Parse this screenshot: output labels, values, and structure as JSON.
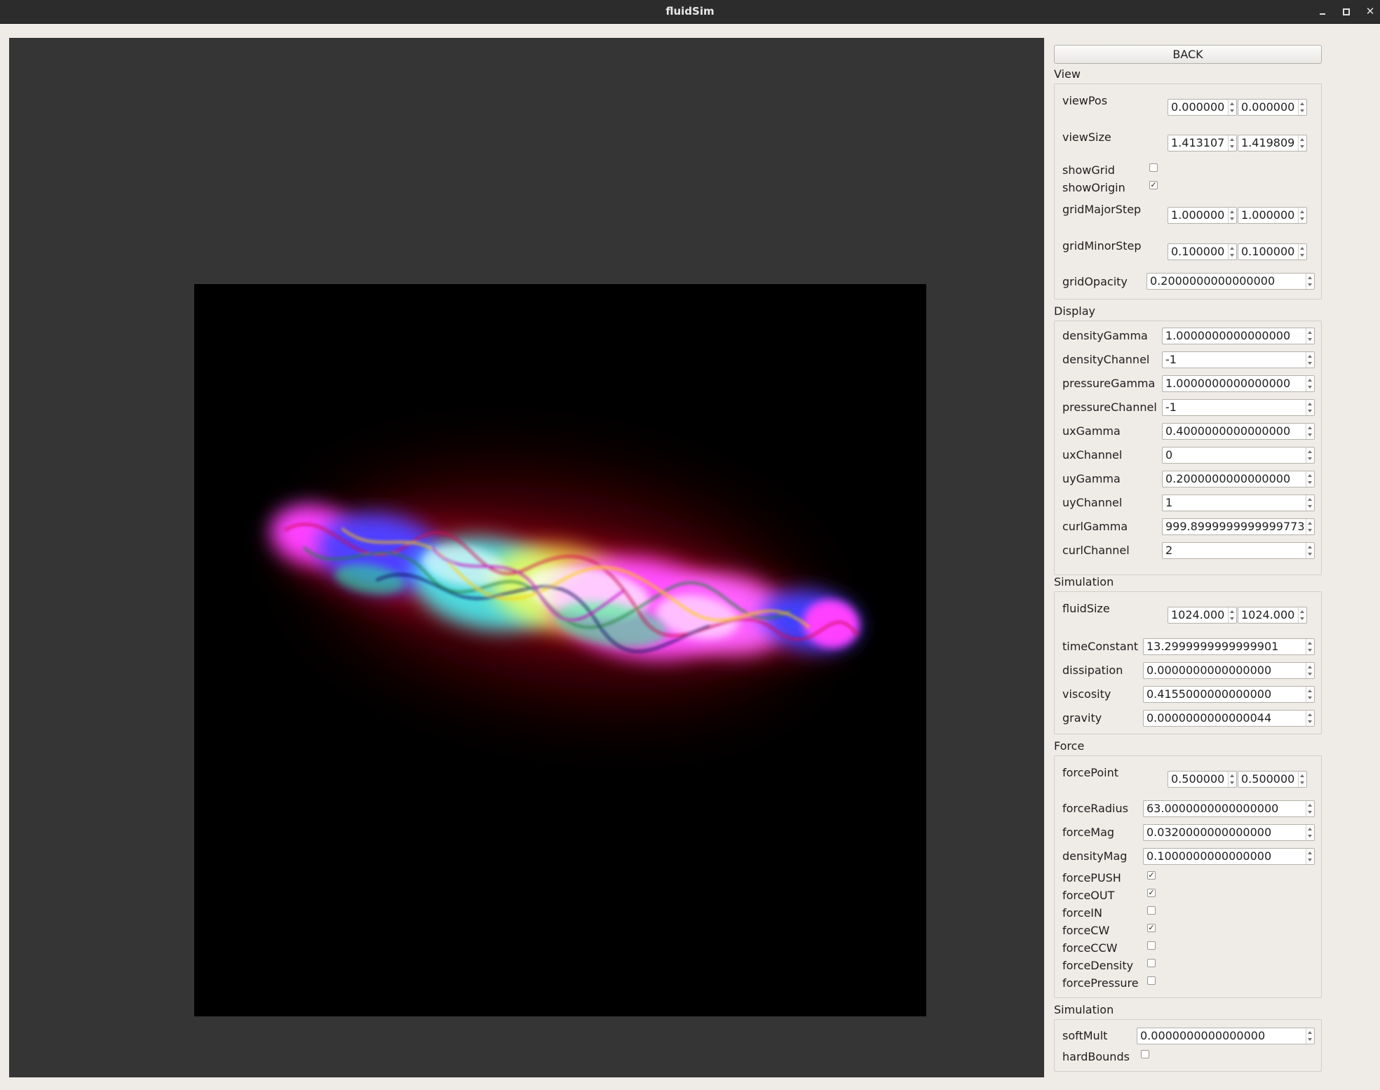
{
  "window": {
    "title": "fluidSim",
    "minimize_icon": "minimize-icon",
    "maximize_icon": "maximize-icon",
    "close_icon": "close-icon",
    "close_glyph": "✕"
  },
  "panel": {
    "back_label": "BACK",
    "view": {
      "title": "View",
      "viewPos": {
        "label": "viewPos",
        "x": "0.000000",
        "y": "0.000000"
      },
      "viewSize": {
        "label": "viewSize",
        "x": "1.413107",
        "y": "1.419809"
      },
      "showGrid": {
        "label": "showGrid",
        "checked": false
      },
      "showOrigin": {
        "label": "showOrigin",
        "checked": true
      },
      "gridMajorStep": {
        "label": "gridMajorStep",
        "x": "1.000000",
        "y": "1.000000"
      },
      "gridMinorStep": {
        "label": "gridMinorStep",
        "x": "0.100000",
        "y": "0.100000"
      },
      "gridOpacity": {
        "label": "gridOpacity",
        "value": "0.2000000000000000"
      }
    },
    "display": {
      "title": "Display",
      "fields": [
        {
          "label": "densityGamma",
          "value": "1.0000000000000000"
        },
        {
          "label": "densityChannel",
          "value": "-1"
        },
        {
          "label": "pressureGamma",
          "value": "1.0000000000000000"
        },
        {
          "label": "pressureChannel",
          "value": "-1"
        },
        {
          "label": "uxGamma",
          "value": "0.4000000000000000"
        },
        {
          "label": "uxChannel",
          "value": "0"
        },
        {
          "label": "uyGamma",
          "value": "0.2000000000000000"
        },
        {
          "label": "uyChannel",
          "value": "1"
        },
        {
          "label": "curlGamma",
          "value": "999.8999999999999773"
        },
        {
          "label": "curlChannel",
          "value": "2"
        }
      ]
    },
    "simulation": {
      "title": "Simulation",
      "fluidSize": {
        "label": "fluidSize",
        "x": "1024.000",
        "y": "1024.000"
      },
      "fields": [
        {
          "label": "timeConstant",
          "value": "13.2999999999999901"
        },
        {
          "label": "dissipation",
          "value": "0.0000000000000000"
        },
        {
          "label": "viscosity",
          "value": "0.4155000000000000"
        },
        {
          "label": "gravity",
          "value": "0.0000000000000044"
        }
      ]
    },
    "force": {
      "title": "Force",
      "forcePoint": {
        "label": "forcePoint",
        "x": "0.500000",
        "y": "0.500000"
      },
      "fields": [
        {
          "label": "forceRadius",
          "value": "63.0000000000000000"
        },
        {
          "label": "forceMag",
          "value": "0.0320000000000000"
        },
        {
          "label": "densityMag",
          "value": "0.1000000000000000"
        }
      ],
      "checks": [
        {
          "label": "forcePUSH",
          "checked": true
        },
        {
          "label": "forceOUT",
          "checked": true
        },
        {
          "label": "forceIN",
          "checked": false
        },
        {
          "label": "forceCW",
          "checked": true
        },
        {
          "label": "forceCCW",
          "checked": false
        },
        {
          "label": "forceDensity",
          "checked": false
        },
        {
          "label": "forcePressure",
          "checked": false
        }
      ]
    },
    "simulation2": {
      "title": "Simulation",
      "softMult": {
        "label": "softMult",
        "value": "0.0000000000000000"
      },
      "hardBounds": {
        "label": "hardBounds",
        "checked": false
      }
    }
  },
  "checkmark": "✓"
}
